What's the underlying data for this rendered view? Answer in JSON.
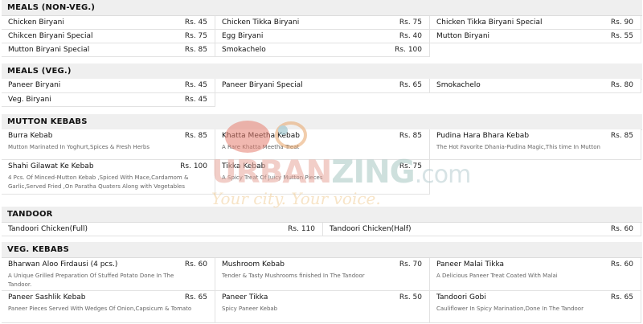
{
  "sections": [
    {
      "title": "MEALS (NON-VEG.)",
      "items": [
        {
          "name": "Chicken Biryani",
          "price": "Rs. 45"
        },
        {
          "name": "Chicken Tikka Biryani",
          "price": "Rs. 75"
        },
        {
          "name": "Chicken Tikka Biryani Special",
          "price": "Rs. 90"
        },
        {
          "name": "Chikcen Biryani Special",
          "price": "Rs. 75"
        },
        {
          "name": "Egg Biryani",
          "price": "Rs. 40"
        },
        {
          "name": "Mutton Biryani",
          "price": "Rs. 55"
        },
        {
          "name": "Mutton Biryani Special",
          "price": "Rs. 85"
        },
        {
          "name": "Smokachelo",
          "price": "Rs. 100"
        }
      ]
    },
    {
      "title": "MEALS (VEG.)",
      "items": [
        {
          "name": "Paneer Biryani",
          "price": "Rs. 45"
        },
        {
          "name": "Paneer Biryani Special",
          "price": "Rs. 65"
        },
        {
          "name": "Smokachelo",
          "price": "Rs. 80"
        },
        {
          "name": "Veg. Biryani",
          "price": "Rs. 45"
        }
      ]
    },
    {
      "title": "MUTTON KEBABS",
      "items": [
        {
          "name": "Burra Kebab",
          "price": "Rs. 85",
          "desc": "Mutton Marinated In Yoghurt,Spices & Fresh Herbs"
        },
        {
          "name": "Khatta Meetha Kebab",
          "price": "Rs. 85",
          "desc": "A Rare Khatta Meetha Treat"
        },
        {
          "name": "Pudina Hara Bhara Kebab",
          "price": "Rs. 85",
          "desc": "The Hot Favorite Dhania-Pudina Magic,This time In Mutton"
        },
        {
          "name": "Shahi Gilawat Ke Kebab",
          "price": "Rs. 100",
          "desc": "4 Pcs. Of Minced-Mutton Kebab ,Spiced With Mace,Cardamom & Garlic,Served Fried ,On Paratha Quaters Along with Vegetables"
        },
        {
          "name": "Tikka Kebab",
          "price": "Rs. 75",
          "desc": "A Spicy Treat Of Juicy Mutton Pieces"
        }
      ]
    },
    {
      "title": "TANDOOR",
      "items": [
        {
          "name": "Tandoori Chicken(Full)",
          "price": "Rs. 110"
        },
        {
          "name": "Tandoori Chicken(Half)",
          "price": "Rs. 60"
        }
      ]
    },
    {
      "title": "VEG. KEBABS",
      "items": [
        {
          "name": "Bharwan Aloo Firdausi (4 pcs.)",
          "price": "Rs. 60",
          "desc": "A Unique Grilled Preparation Of Stuffed Potato Done In The Tandoor."
        },
        {
          "name": "Mushroom Kebab",
          "price": "Rs. 70",
          "desc": "Tender & Tasty Mushrooms finished In The Tandoor"
        },
        {
          "name": "Paneer Malai Tikka",
          "price": "Rs. 60",
          "desc": "A Delicious Paneer Treat Coated With Malai"
        },
        {
          "name": "Paneer Sashlik Kebab",
          "price": "Rs. 65",
          "desc": "Paneer Pieces Served With Wedges Of Onion,Capsicum & Tomato"
        },
        {
          "name": "Paneer Tikka",
          "price": "Rs. 50",
          "desc": "Spicy Paneer Kebab"
        },
        {
          "name": "Tandoori Gobi",
          "price": "Rs. 65",
          "desc": "Cauliflower In Spicy Marination,Done In The Tandoor"
        }
      ]
    }
  ],
  "watermark": {
    "brand_a": "URBAN",
    "brand_b": "ZING",
    "domain": ".com",
    "tagline": "Your city. Your voice."
  }
}
